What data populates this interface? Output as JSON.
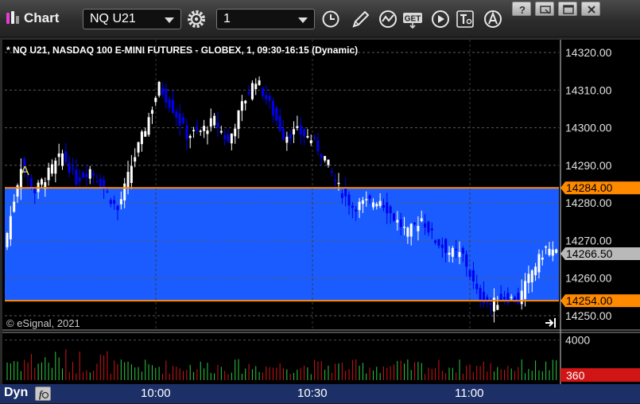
{
  "toolbar": {
    "app_title": "Chart",
    "symbol": "NQ U21",
    "interval": "1",
    "buttons": [
      "gear-icon",
      "clock-icon",
      "pencil-icon",
      "study-icon",
      "get-icon",
      "play-icon",
      "text-tool-icon",
      "alert-icon"
    ],
    "get_label": "GET"
  },
  "window_controls": [
    "help-icon",
    "restore-icon",
    "maximize-icon",
    "close-icon"
  ],
  "chart": {
    "title": "* NQ U21, NASDAQ 100 E-MINI FUTURES - GLOBEX, 1, 09:30-16:15 (Dynamic)",
    "copyright": "© eSignal, 2021",
    "annotation_marker": "A",
    "colors": {
      "up": "#ffffff",
      "down": "#0000ee",
      "band": "#1a5cff",
      "band_line": "#ff8a00",
      "last_price_box": "#b9b9b9",
      "volume_up": "#2ecc40",
      "volume_down": "#d11414"
    }
  },
  "chart_data": {
    "type": "candlestick",
    "price_axis": {
      "ticks": [
        "14320.00",
        "14310.00",
        "14300.00",
        "14290.00",
        "14280.00",
        "14270.00",
        "14260.00",
        "14250.00"
      ],
      "range": [
        14248,
        14325
      ]
    },
    "x_axis": {
      "ticks": [
        "10:00",
        "10:30",
        "11:00"
      ]
    },
    "price_labels": [
      {
        "label": "14284.00",
        "value": 14284,
        "kind": "band-top"
      },
      {
        "label": "14266.50",
        "value": 14266.5,
        "kind": "last-price"
      },
      {
        "label": "14254.00",
        "value": 14254,
        "kind": "band-bottom"
      }
    ],
    "shaded_band": [
      14254,
      14284
    ],
    "close_path": [
      [
        0,
        14272
      ],
      [
        4,
        14290
      ],
      [
        8,
        14283
      ],
      [
        12,
        14288
      ],
      [
        16,
        14293
      ],
      [
        20,
        14286
      ],
      [
        24,
        14289
      ],
      [
        28,
        14284
      ],
      [
        32,
        14278
      ],
      [
        36,
        14290
      ],
      [
        40,
        14300
      ],
      [
        44,
        14311
      ],
      [
        48,
        14305
      ],
      [
        52,
        14298
      ],
      [
        56,
        14299
      ],
      [
        60,
        14302
      ],
      [
        64,
        14296
      ],
      [
        68,
        14306
      ],
      [
        72,
        14313
      ],
      [
        76,
        14306
      ],
      [
        80,
        14298
      ],
      [
        84,
        14299
      ],
      [
        88,
        14297
      ],
      [
        92,
        14292
      ],
      [
        96,
        14284
      ],
      [
        100,
        14279
      ],
      [
        104,
        14280
      ],
      [
        108,
        14281
      ],
      [
        112,
        14276
      ],
      [
        116,
        14272
      ],
      [
        120,
        14276
      ],
      [
        124,
        14270
      ],
      [
        128,
        14267
      ],
      [
        132,
        14266
      ],
      [
        136,
        14256
      ],
      [
        140,
        14253
      ],
      [
        144,
        14255
      ],
      [
        148,
        14254
      ],
      [
        152,
        14262
      ],
      [
        156,
        14268
      ],
      [
        159,
        14266.5
      ]
    ],
    "volume_axis": {
      "ticks": [
        "4000"
      ],
      "range": [
        0,
        4600
      ]
    },
    "volume_label": "360"
  },
  "bottom_bar": {
    "label": "Dyn"
  }
}
